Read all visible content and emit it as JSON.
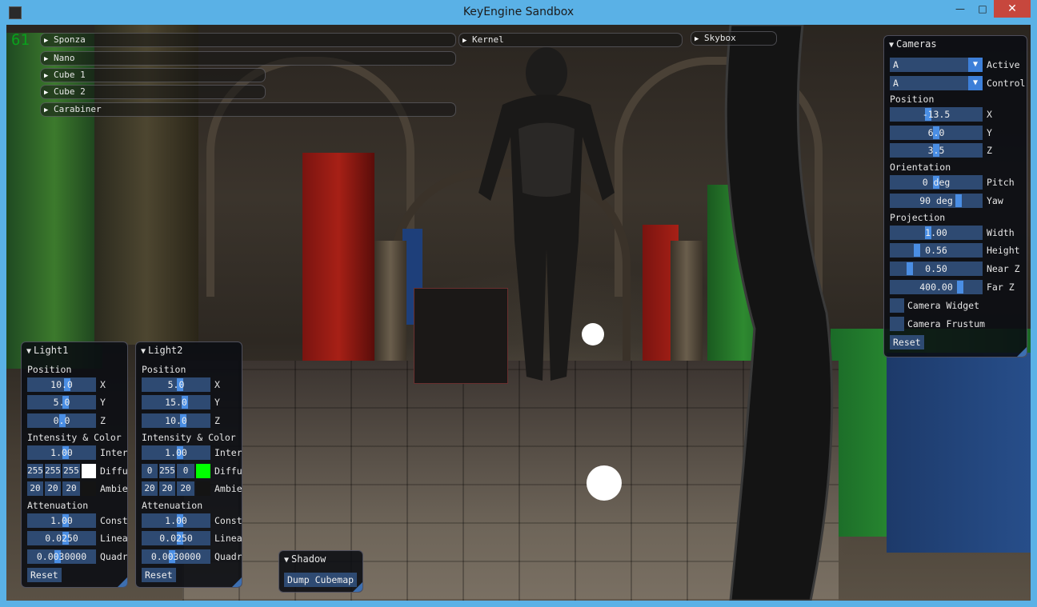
{
  "window": {
    "title": "KeyEngine Sandbox",
    "minimize": "—",
    "maximize": "□",
    "close": "✕"
  },
  "fps": "61",
  "object_headers": [
    {
      "label": "Sponza"
    },
    {
      "label": "Nano"
    },
    {
      "label": "Cube 1"
    },
    {
      "label": "Cube 2"
    },
    {
      "label": "Carabiner"
    },
    {
      "label": "Kernel"
    },
    {
      "label": "Skybox"
    }
  ],
  "cameras": {
    "title": "Cameras",
    "active": {
      "value": "A",
      "label": "Active"
    },
    "control": {
      "value": "A",
      "label": "Control"
    },
    "position_label": "Position",
    "x": {
      "value": "-13.5",
      "label": "X"
    },
    "y": {
      "value": "6.0",
      "label": "Y"
    },
    "z": {
      "value": "3.5",
      "label": "Z"
    },
    "orientation_label": "Orientation",
    "pitch": {
      "value": "0 deg",
      "label": "Pitch"
    },
    "yaw": {
      "value": "90 deg",
      "label": "Yaw"
    },
    "projection_label": "Projection",
    "width": {
      "value": "1.00",
      "label": "Width"
    },
    "height": {
      "value": "0.56",
      "label": "Height"
    },
    "nearz": {
      "value": "0.50",
      "label": "Near Z"
    },
    "farz": {
      "value": "400.00",
      "label": "Far Z"
    },
    "camera_widget": "Camera Widget",
    "camera_frustum": "Camera Frustum",
    "reset": "Reset"
  },
  "light1": {
    "title": "Light1",
    "position_label": "Position",
    "x": "10.0",
    "y": "5.0",
    "z": "0.0",
    "x_label": "X",
    "y_label": "Y",
    "z_label": "Z",
    "intensity_color_label": "Intensity & Color",
    "intensity": "1.00",
    "intensity_label": "Inter",
    "diffuse": [
      "255",
      "255",
      "255"
    ],
    "diffuse_label": "Diffu",
    "diffuse_color": "#ffffff",
    "ambient": [
      "20",
      "20",
      "20"
    ],
    "ambient_label": "Ambie",
    "ambient_color": "#141414",
    "attenuation_label": "Attenuation",
    "constant": "1.00",
    "constant_label": "Const",
    "linear": "0.0250",
    "linear_label": "Linea",
    "quadratic": "0.0030000",
    "quadratic_label": "Quadr",
    "reset": "Reset"
  },
  "light2": {
    "title": "Light2",
    "position_label": "Position",
    "x": "5.0",
    "y": "15.0",
    "z": "10.0",
    "x_label": "X",
    "y_label": "Y",
    "z_label": "Z",
    "intensity_color_label": "Intensity & Color",
    "intensity": "1.00",
    "intensity_label": "Inter",
    "diffuse": [
      "0",
      "255",
      "0"
    ],
    "diffuse_label": "Diffu",
    "diffuse_color": "#00ff00",
    "ambient": [
      "20",
      "20",
      "20"
    ],
    "ambient_label": "Ambie",
    "ambient_color": "#141414",
    "attenuation_label": "Attenuation",
    "constant": "1.00",
    "constant_label": "Const",
    "linear": "0.0250",
    "linear_label": "Linea",
    "quadratic": "0.0030000",
    "quadratic_label": "Quadr",
    "reset": "Reset"
  },
  "shadow": {
    "title": "Shadow",
    "dump_cubemap": "Dump Cubemap"
  },
  "colors": {
    "field": "#2e4a72",
    "grab": "#4a8ee4",
    "fps": "#0aa01c",
    "titlebar": "#5ab1e6",
    "close": "#c7473d"
  }
}
